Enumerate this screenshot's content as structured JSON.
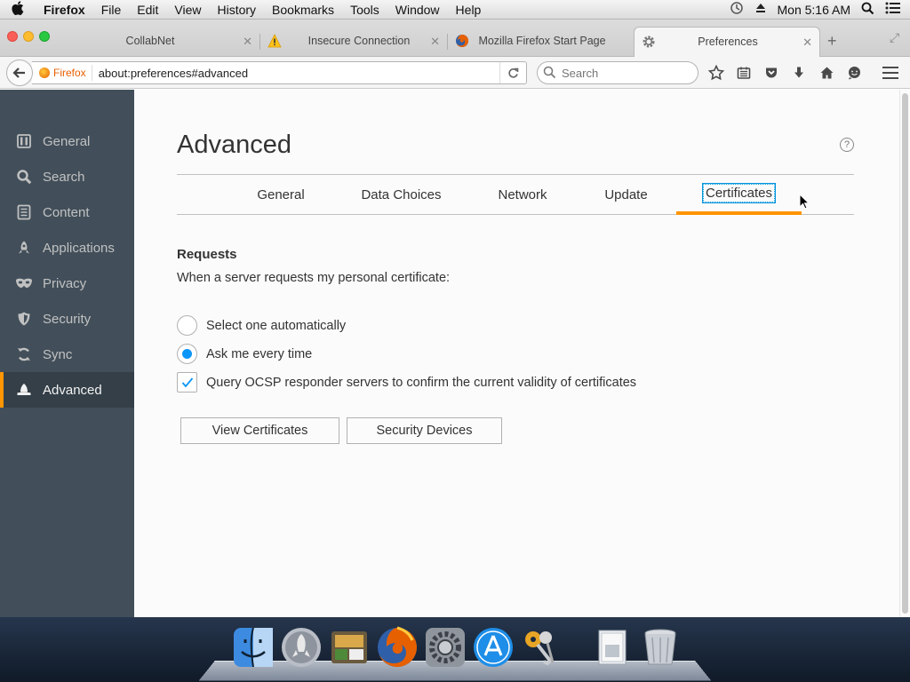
{
  "menubar": {
    "app": "Firefox",
    "items": [
      "File",
      "Edit",
      "View",
      "History",
      "Bookmarks",
      "Tools",
      "Window",
      "Help"
    ],
    "clock": "Mon 5:16 AM"
  },
  "tabs": [
    {
      "title": "CollabNet"
    },
    {
      "title": "Insecure Connection"
    },
    {
      "title": "Mozilla Firefox Start Page"
    },
    {
      "title": "Preferences"
    }
  ],
  "navbar": {
    "identity_label": "Firefox",
    "url": "about:preferences#advanced",
    "search_placeholder": "Search"
  },
  "sidebar": {
    "items": [
      {
        "label": "General",
        "icon": "general-icon"
      },
      {
        "label": "Search",
        "icon": "search-icon"
      },
      {
        "label": "Content",
        "icon": "content-icon"
      },
      {
        "label": "Applications",
        "icon": "applications-icon"
      },
      {
        "label": "Privacy",
        "icon": "privacy-mask-icon"
      },
      {
        "label": "Security",
        "icon": "security-icon"
      },
      {
        "label": "Sync",
        "icon": "sync-icon"
      },
      {
        "label": "Advanced",
        "icon": "advanced-hat-icon"
      }
    ],
    "selected": "Advanced"
  },
  "main": {
    "title": "Advanced",
    "help_glyph": "?",
    "subtabs": [
      "General",
      "Data Choices",
      "Network",
      "Update",
      "Certificates"
    ],
    "selected_subtab": "Certificates",
    "requests": {
      "title": "Requests",
      "description": "When a server requests my personal certificate:",
      "options": [
        "Select one automatically",
        "Ask me every time"
      ],
      "selected_option": "Ask me every time"
    },
    "ocsp": {
      "label": "Query OCSP responder servers to confirm the current validity of certificates",
      "checked": true
    },
    "buttons": {
      "view_certificates": "View Certificates",
      "security_devices": "Security Devices"
    }
  },
  "colors": {
    "accent": "#ff9500",
    "sidebar_bg": "#424f5a",
    "selected_blue": "#0996f8"
  },
  "dock": [
    "Finder",
    "Launchpad",
    "Preview",
    "Firefox",
    "System Preferences",
    "App Store",
    "Keychain Access",
    "Documents",
    "Trash"
  ]
}
